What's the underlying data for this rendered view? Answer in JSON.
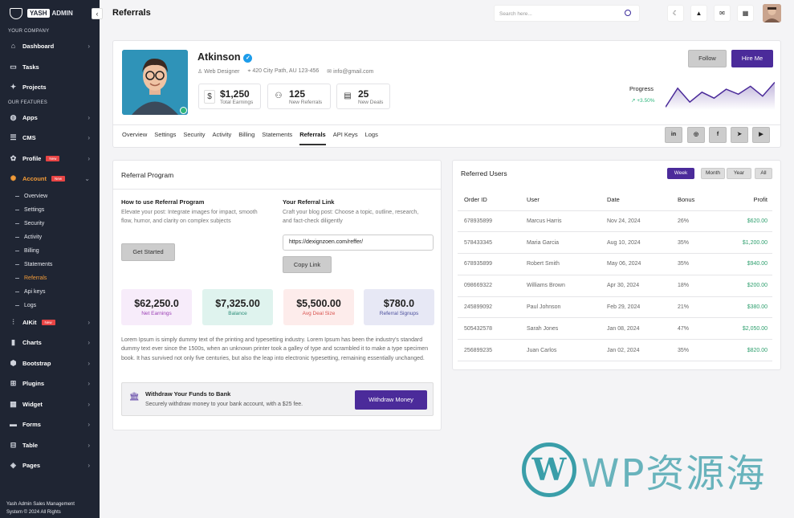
{
  "sidebar": {
    "brand_badge": "YASH",
    "brand": "ADMIN",
    "section_company": "YOUR COMPANY",
    "section_features": "OUR FEATURES",
    "items": [
      {
        "label": "Dashboard",
        "icon": "home-icon"
      },
      {
        "label": "Tasks",
        "icon": "tasks-icon"
      },
      {
        "label": "Projects",
        "icon": "projects-icon"
      },
      {
        "label": "Apps",
        "icon": "apps-icon"
      },
      {
        "label": "CMS",
        "icon": "cms-icon"
      },
      {
        "label": "Profile",
        "icon": "profile-icon",
        "badge": "New"
      },
      {
        "label": "Account",
        "icon": "account-icon",
        "badge": "New"
      },
      {
        "label": "AIKit",
        "icon": "aikit-icon",
        "badge": "New"
      },
      {
        "label": "Charts",
        "icon": "charts-icon"
      },
      {
        "label": "Bootstrap",
        "icon": "bootstrap-icon"
      },
      {
        "label": "Plugins",
        "icon": "plugins-icon"
      },
      {
        "label": "Widget",
        "icon": "widget-icon"
      },
      {
        "label": "Forms",
        "icon": "forms-icon"
      },
      {
        "label": "Table",
        "icon": "table-icon"
      },
      {
        "label": "Pages",
        "icon": "pages-icon"
      }
    ],
    "account_sub": [
      "Overview",
      "Settings",
      "Security",
      "Activity",
      "Billing",
      "Statements",
      "Referrals",
      "Api keys",
      "Logs"
    ],
    "footer_line1": "Yash Admin Sales Management",
    "footer_line2": "System © 2024 All Rights"
  },
  "header": {
    "title": "Referrals",
    "search_placeholder": "Search here..."
  },
  "profile": {
    "name": "Atkinson",
    "role": "Web Designer",
    "address": "420 City Path, AU 123-456",
    "email": "info@gmail.com",
    "stats": [
      {
        "value": "$1,250",
        "label": "Total Earnings"
      },
      {
        "value": "125",
        "label": "New Referrals"
      },
      {
        "value": "25",
        "label": "New Deals"
      }
    ],
    "follow_label": "Follow",
    "hire_label": "Hire Me",
    "progress_label": "Progress",
    "progress_value": "+3.50%",
    "tabs": [
      "Overview",
      "Settings",
      "Security",
      "Activity",
      "Billing",
      "Statements",
      "Referrals",
      "API Keys",
      "Logs"
    ],
    "active_tab": "Referrals",
    "social": [
      "in",
      "ig",
      "f",
      "tg",
      "yt"
    ]
  },
  "sparkline": [
    3,
    22,
    8,
    18,
    12,
    21,
    16,
    24,
    14,
    28
  ],
  "referral": {
    "title": "Referral Program",
    "how_title": "How to use Referral Program",
    "how_text": "Elevate your post: Integrate images for impact, smooth flow, humor, and clarity on complex subjects",
    "get_started": "Get Started",
    "link_title": "Your Referral Link",
    "link_text": "Craft your blog post: Choose a topic, outline, research, and fact-check diligently",
    "link_value": "https://dexignzoen.com/reffer/",
    "copy_label": "Copy Link",
    "kpis": [
      {
        "value": "$62,250.0",
        "label": "Net Earnings",
        "bg": "#f7ecfa",
        "fg": "#9b3fb4"
      },
      {
        "value": "$7,325.00",
        "label": "Balance",
        "bg": "#dff3ee",
        "fg": "#2e8f7a"
      },
      {
        "value": "$5,500.00",
        "label": "Avg Deal Size",
        "bg": "#fdeceb",
        "fg": "#d9534f"
      },
      {
        "value": "$780.0",
        "label": "Referral Signups",
        "bg": "#e7e8f5",
        "fg": "#4b4f9c"
      }
    ],
    "lorem": "Lorem Ipsum is simply dummy text of the printing and typesetting industry. Lorem Ipsum has been the industry's standard dummy text ever since the 1500s, when an unknown printer took a galley of type and scrambled it to make a type specimen book. It has survived not only five centuries, but also the leap into electronic typesetting, remaining essentially unchanged.",
    "withdraw_title": "Withdraw Your Funds to Bank",
    "withdraw_text": "Securely withdraw money to your bank account, with a $25 fee.",
    "withdraw_button": "Withdraw Money"
  },
  "referred": {
    "title": "Referred Users",
    "filters": [
      "Week",
      "Month",
      "Year",
      "All"
    ],
    "active_filter": "Week",
    "columns": [
      "Order ID",
      "User",
      "Date",
      "Bonus",
      "Profit"
    ],
    "rows": [
      [
        "678935899",
        "Marcus Harris",
        "Nov 24, 2024",
        "26%",
        "$620.00"
      ],
      [
        "578433345",
        "Maria Garcia",
        "Aug 10, 2024",
        "35%",
        "$1,200.00"
      ],
      [
        "678935899",
        "Robert Smith",
        "May 06, 2024",
        "35%",
        "$940.00"
      ],
      [
        "098669322",
        "Williams Brown",
        "Apr 30, 2024",
        "18%",
        "$200.00"
      ],
      [
        "245899092",
        "Paul Johnson",
        "Feb 29, 2024",
        "21%",
        "$380.00"
      ],
      [
        "505432578",
        "Sarah Jones",
        "Jan 08, 2024",
        "47%",
        "$2,050.00"
      ],
      [
        "256899235",
        "Juan Carlos",
        "Jan 02, 2024",
        "35%",
        "$820.00"
      ]
    ]
  },
  "watermark": "WP资源海"
}
